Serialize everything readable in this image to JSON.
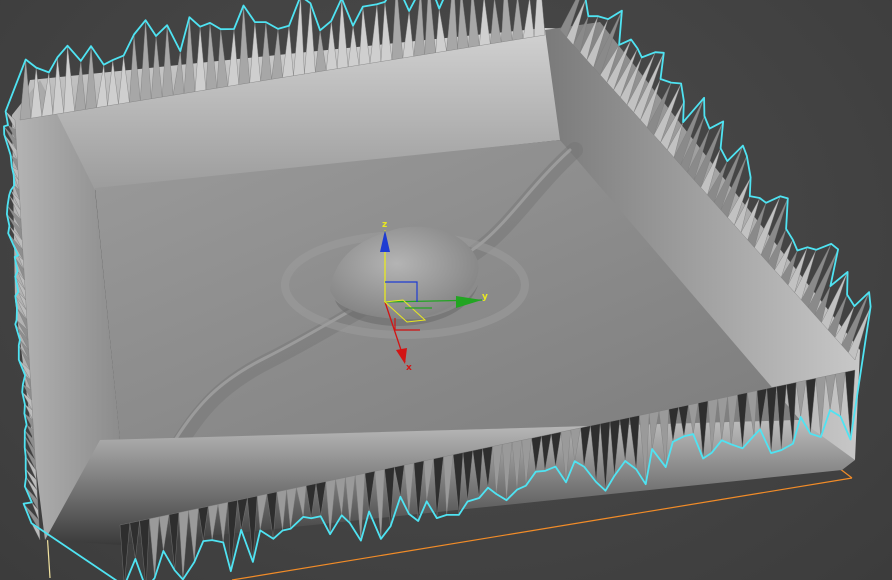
{
  "viewport": {
    "background_color": "#454545",
    "selection_outline_color": "#4fe3f2",
    "bounding_box_color": "#f28c28"
  },
  "gizmo": {
    "axes": [
      {
        "label": "x",
        "color": "#d21414",
        "icon": "x-axis-arrow-icon"
      },
      {
        "label": "y",
        "color": "#22a522",
        "icon": "y-axis-arrow-icon"
      },
      {
        "label": "z",
        "color": "#1e3cd2",
        "icon": "z-axis-arrow-icon"
      }
    ]
  },
  "terrain": {
    "surface_color": "#8e8e8e",
    "wall_color": "#a8a8a8"
  }
}
